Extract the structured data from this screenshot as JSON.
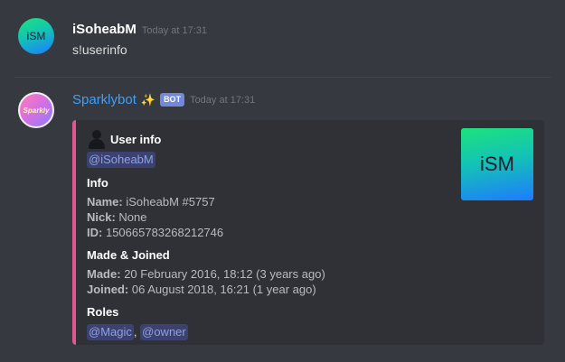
{
  "messages": [
    {
      "avatar_text": "iSM",
      "username": "iSoheabM",
      "timestamp": "Today at 17:31",
      "content": "s!userinfo"
    },
    {
      "avatar_text": "Sparkly",
      "username": "Sparklybot",
      "sparkle_icon": "✨",
      "bot_tag": "BOT",
      "timestamp": "Today at 17:31",
      "embed": {
        "accent_color": "#e0568f",
        "author": "User info",
        "author_icon": "user-silhouette-icon",
        "mention": "@iSoheabM",
        "thumbnail_text": "iSM",
        "sections": {
          "info": {
            "title": "Info",
            "name_label": "Name:",
            "name_value": "iSoheabM #5757",
            "nick_label": "Nick:",
            "nick_value": "None",
            "id_label": "ID:",
            "id_value": "150665783268212746"
          },
          "made": {
            "title": "Made & Joined",
            "made_label": "Made:",
            "made_value": "20 February 2016, 18:12 (3 years ago)",
            "joined_label": "Joined:",
            "joined_value": "06 August 2018, 16:21 (1 year ago)"
          },
          "roles": {
            "title": "Roles",
            "role1": "@Magic",
            "separator": ",",
            "role2": "@owner"
          }
        }
      }
    }
  ]
}
